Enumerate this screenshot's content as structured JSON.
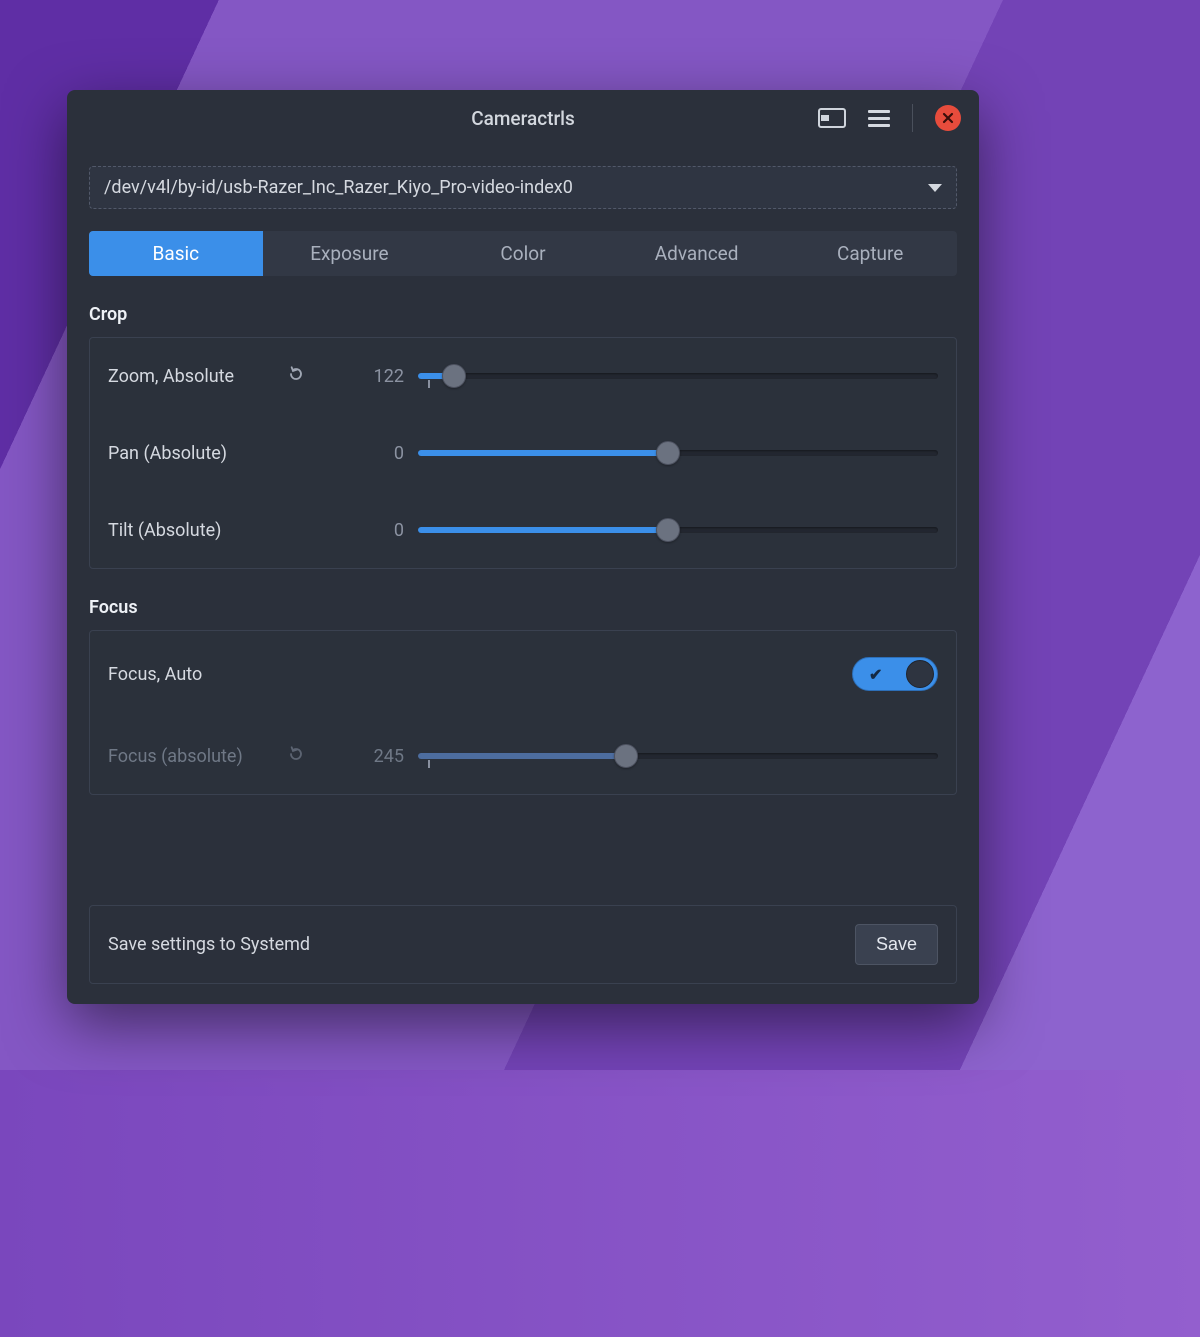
{
  "window": {
    "title": "Cameractrls"
  },
  "device": {
    "path": "/dev/v4l/by-id/usb-Razer_Inc_Razer_Kiyo_Pro-video-index0"
  },
  "tabs": [
    "Basic",
    "Exposure",
    "Color",
    "Advanced",
    "Capture"
  ],
  "active_tab": "Basic",
  "sections": {
    "crop": {
      "title": "Crop",
      "controls": {
        "zoom": {
          "label": "Zoom, Absolute",
          "value": "122",
          "resettable": true,
          "fill_pct": 7,
          "tick_pct": 2
        },
        "pan": {
          "label": "Pan (Absolute)",
          "value": "0",
          "resettable": false,
          "fill_pct": 48
        },
        "tilt": {
          "label": "Tilt (Absolute)",
          "value": "0",
          "resettable": false,
          "fill_pct": 48
        }
      }
    },
    "focus": {
      "title": "Focus",
      "controls": {
        "auto": {
          "label": "Focus, Auto",
          "on": true
        },
        "abs": {
          "label": "Focus (absolute)",
          "value": "245",
          "resettable": true,
          "fill_pct": 40,
          "tick_pct": 2,
          "disabled": true
        }
      }
    }
  },
  "footer": {
    "label": "Save settings to Systemd",
    "button": "Save"
  },
  "colors": {
    "accent": "#3b8fe9",
    "window_bg": "#2b303b",
    "close": "#e74c3c"
  }
}
